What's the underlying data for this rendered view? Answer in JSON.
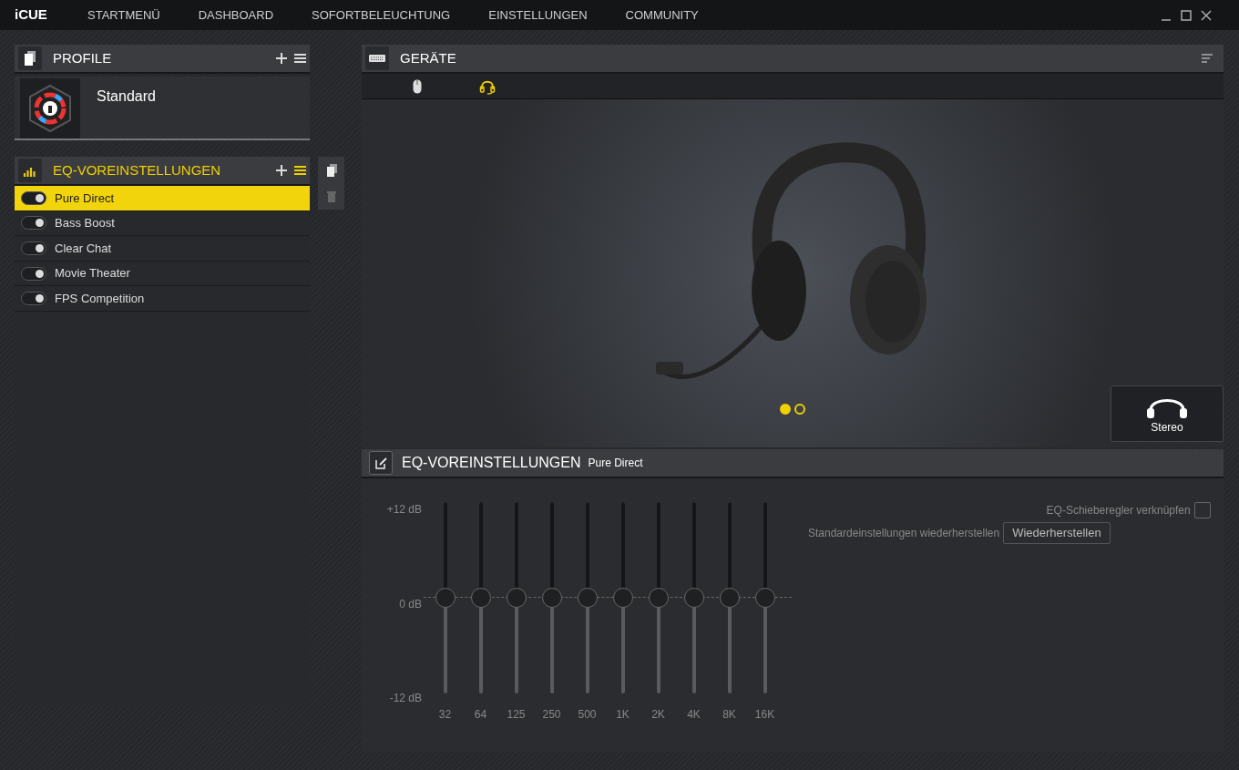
{
  "app": {
    "logo": "iCUE"
  },
  "nav": [
    {
      "label": "STARTMENÜ",
      "selected": false
    },
    {
      "label": "DASHBOARD",
      "selected": false
    },
    {
      "label": "SOFORTBELEUCHTUNG",
      "selected": false
    },
    {
      "label": "EINSTELLUNGEN",
      "selected": false
    },
    {
      "label": "COMMUNITY",
      "selected": false
    }
  ],
  "profiles": {
    "title": "PROFILE",
    "items": [
      {
        "name": "Standard",
        "selected": true
      }
    ]
  },
  "eq_presets": {
    "title": "EQ-VOREINSTELLUNGEN",
    "items": [
      {
        "name": "Pure Direct",
        "on": true,
        "selected": true
      },
      {
        "name": "Bass Boost",
        "on": true,
        "selected": false
      },
      {
        "name": "Clear Chat",
        "on": true,
        "selected": false
      },
      {
        "name": "Movie Theater",
        "on": true,
        "selected": false
      },
      {
        "name": "FPS Competition",
        "on": true,
        "selected": false
      }
    ]
  },
  "devices": {
    "title": "GERÄTE",
    "tabs": [
      {
        "kind": "mouse",
        "selected": false
      },
      {
        "kind": "headset",
        "selected": true
      }
    ],
    "carousel": [
      {
        "selected": true
      },
      {
        "selected": false
      }
    ],
    "mode_button": "Stereo"
  },
  "equalizer": {
    "title": "EQ-VOREINSTELLUNGEN",
    "preset": "Pure Direct",
    "scale": [
      "+12 dB",
      "0 dB",
      "-12 dB"
    ],
    "bands": [
      {
        "label": "32",
        "level": 0.5
      },
      {
        "label": "64",
        "level": 0.5
      },
      {
        "label": "125",
        "level": 0.5
      },
      {
        "label": "250",
        "level": 0.5
      },
      {
        "label": "500",
        "level": 0.5
      },
      {
        "label": "1K",
        "level": 0.5
      },
      {
        "label": "2K",
        "level": 0.5
      },
      {
        "label": "4K",
        "level": 0.5
      },
      {
        "label": "8K",
        "level": 0.5
      },
      {
        "label": "16K",
        "level": 0.5
      }
    ],
    "link_label": "EQ-Schieberegler verknüpfen",
    "link_checked": false,
    "reset_label": "Standardeinstellungen wiederherstellen",
    "reset_button": "Wiederherstellen"
  }
}
